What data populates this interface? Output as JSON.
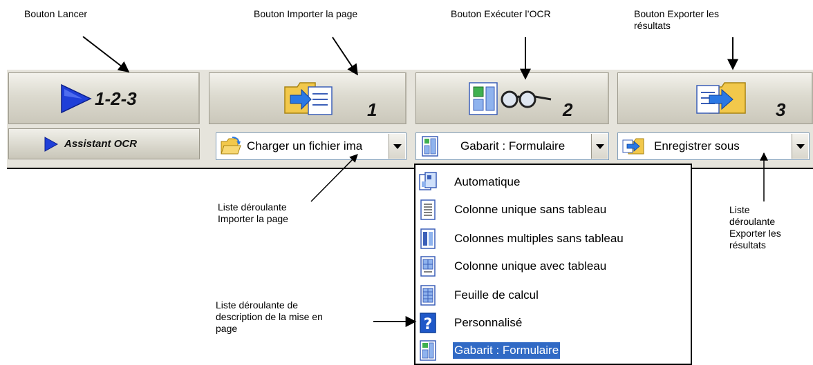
{
  "callouts": {
    "launch": "Bouton Lancer",
    "import": "Bouton Importer la page",
    "ocr": "Bouton Exécuter l’OCR",
    "export_line1": "Bouton Exporter les",
    "export_line2": "résultats",
    "import_list_line1": "Liste déroulante",
    "import_list_line2": "Importer la page",
    "export_list_line1": "Liste",
    "export_list_line2": "déroulante",
    "export_list_line3": "Exporter les",
    "export_list_line4": "résultats",
    "layout_list_line1": "Liste déroulante de",
    "layout_list_line2": "description de la mise en",
    "layout_list_line3": "page"
  },
  "toolbar": {
    "launch_label": "1-2-3",
    "import_step": "1",
    "ocr_step": "2",
    "export_step": "3",
    "assistant_label": "Assistant OCR",
    "import_combo_value": "Charger un fichier ima",
    "layout_combo_value": "Gabarit : Formulaire",
    "export_combo_value": "Enregistrer sous"
  },
  "layout_options": [
    "Automatique",
    "Colonne unique sans tableau",
    "Colonnes multiples sans tableau",
    "Colonne unique avec tableau",
    "Feuille de calcul",
    "Personnalisé",
    "Gabarit : Formulaire"
  ],
  "selected_option": "Gabarit : Formulaire",
  "colors": {
    "selection": "#316ac5",
    "play_blue": "#1f3fd8",
    "folder_yellow": "#f2c84b"
  }
}
